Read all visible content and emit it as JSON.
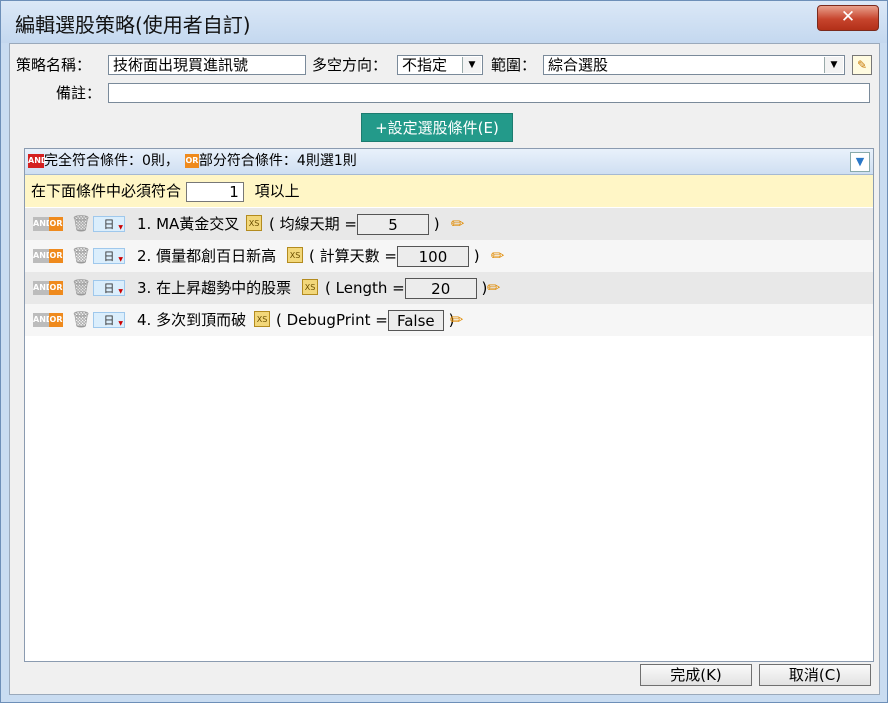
{
  "window": {
    "title": "編輯選股策略(使用者自訂)",
    "close_icon": "✕"
  },
  "form": {
    "strategy_name_label": "策略名稱：",
    "strategy_name_value": "技術面出現買進訊號",
    "direction_label": "多空方向：",
    "direction_value": "不指定",
    "scope_label": "範圍：",
    "scope_value": "綜合選股",
    "note_label": "備註：",
    "note_value": ""
  },
  "set_condition_button": "+設定選股條件(E)",
  "summary": {
    "and_tag": "AND",
    "full_match": "完全符合條件：0則，",
    "or_tag": "OR",
    "partial_match": "部分符合條件：4則選1則"
  },
  "must_row": {
    "prefix": "在下面條件中必須符合",
    "count": "1",
    "suffix": "項以上"
  },
  "condition_tags": {
    "and": "AND",
    "or": "OR",
    "freq": "日",
    "xs": "XS"
  },
  "conditions": [
    {
      "name": "1. MA黃金交叉",
      "param_label": "均線天期 =",
      "param_value": "5"
    },
    {
      "name": "2. 價量都創百日新高",
      "param_label": "計算天數 =",
      "param_value": "100"
    },
    {
      "name": "3. 在上昇趨勢中的股票",
      "param_label": "Length =",
      "param_value": "20"
    },
    {
      "name": "4. 多次到頂而破",
      "param_label": "DebugPrint =",
      "param_value": "False"
    }
  ],
  "buttons": {
    "ok": "完成(K)",
    "cancel": "取消(C)"
  },
  "colors": {
    "green_button": "#239a8a",
    "highlight_row": "#fff6c6",
    "or_tag": "#ef8a1d"
  }
}
